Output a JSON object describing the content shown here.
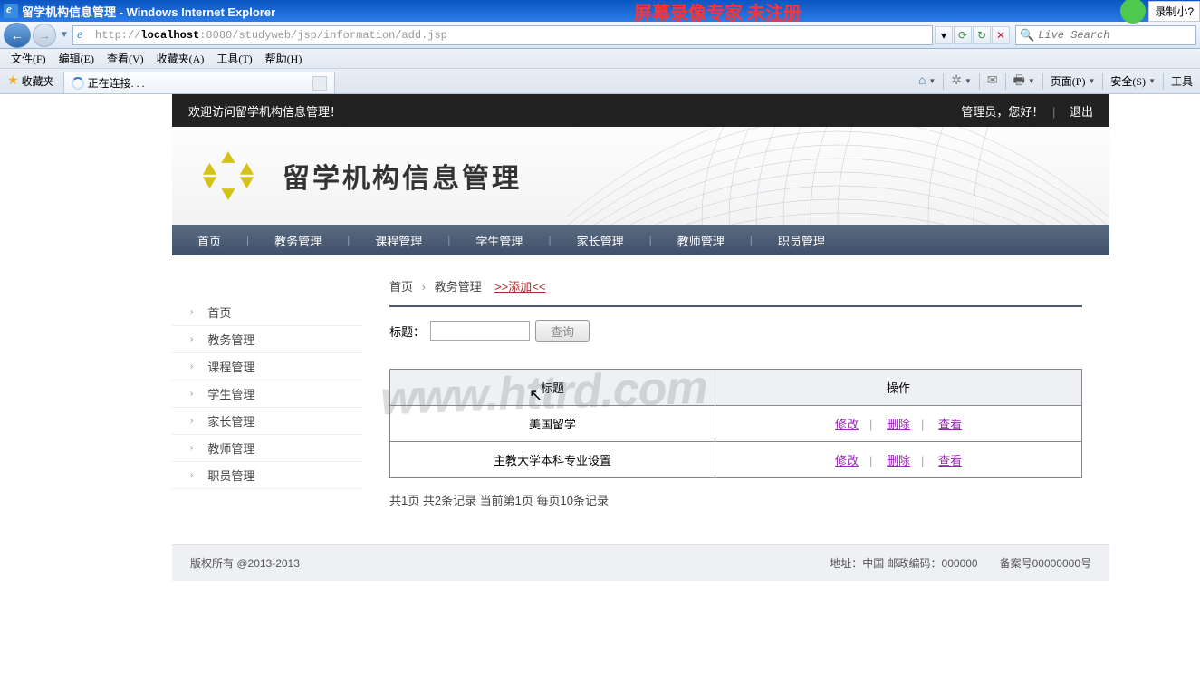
{
  "titlebar": {
    "title": "留学机构信息管理 - Windows Internet Explorer",
    "overlay": "屏幕录像专家  未注册",
    "rec": "录制小?"
  },
  "addr": {
    "pre": "http://",
    "host": "localhost",
    "path": ":8080/studyweb/jsp/information/add.jsp"
  },
  "search_placeholder": "Live Search",
  "menus": [
    "文件(F)",
    "编辑(E)",
    "查看(V)",
    "收藏夹(A)",
    "工具(T)",
    "帮助(H)"
  ],
  "fav_label": "收藏夹",
  "tab_label": "正在连接. . .",
  "toolbar_right": {
    "page": "页面(P)",
    "safety": "安全(S)",
    "tools": "工具"
  },
  "welcome": {
    "left": "欢迎访问留学机构信息管理！",
    "user": "管理员，您好！",
    "logout": "退出"
  },
  "site_title": "留学机构信息管理",
  "topnav": [
    "首页",
    "教务管理",
    "课程管理",
    "学生管理",
    "家长管理",
    "教师管理",
    "职员管理"
  ],
  "sidebar": [
    "首页",
    "教务管理",
    "课程管理",
    "学生管理",
    "家长管理",
    "教师管理",
    "职员管理"
  ],
  "crumb": {
    "a": "首页",
    "b": "教务管理",
    "add_pre": ">>",
    "add": "添加",
    "add_post": "<<"
  },
  "search": {
    "label": "标题：",
    "btn": "查询"
  },
  "table": {
    "headers": [
      "标题",
      "操作"
    ],
    "rows": [
      {
        "title": "美国留学"
      },
      {
        "title": "主教大学本科专业设置"
      }
    ],
    "ops": {
      "edit": "修改",
      "delete": "删除",
      "view": "查看"
    }
  },
  "pager": "共1页 共2条记录 当前第1页 每页10条记录",
  "footer": {
    "left": "版权所有 @2013-2013",
    "right": "地址：中国 邮政编码：000000　　备案号00000000号"
  },
  "watermark": "www.httrd.com"
}
